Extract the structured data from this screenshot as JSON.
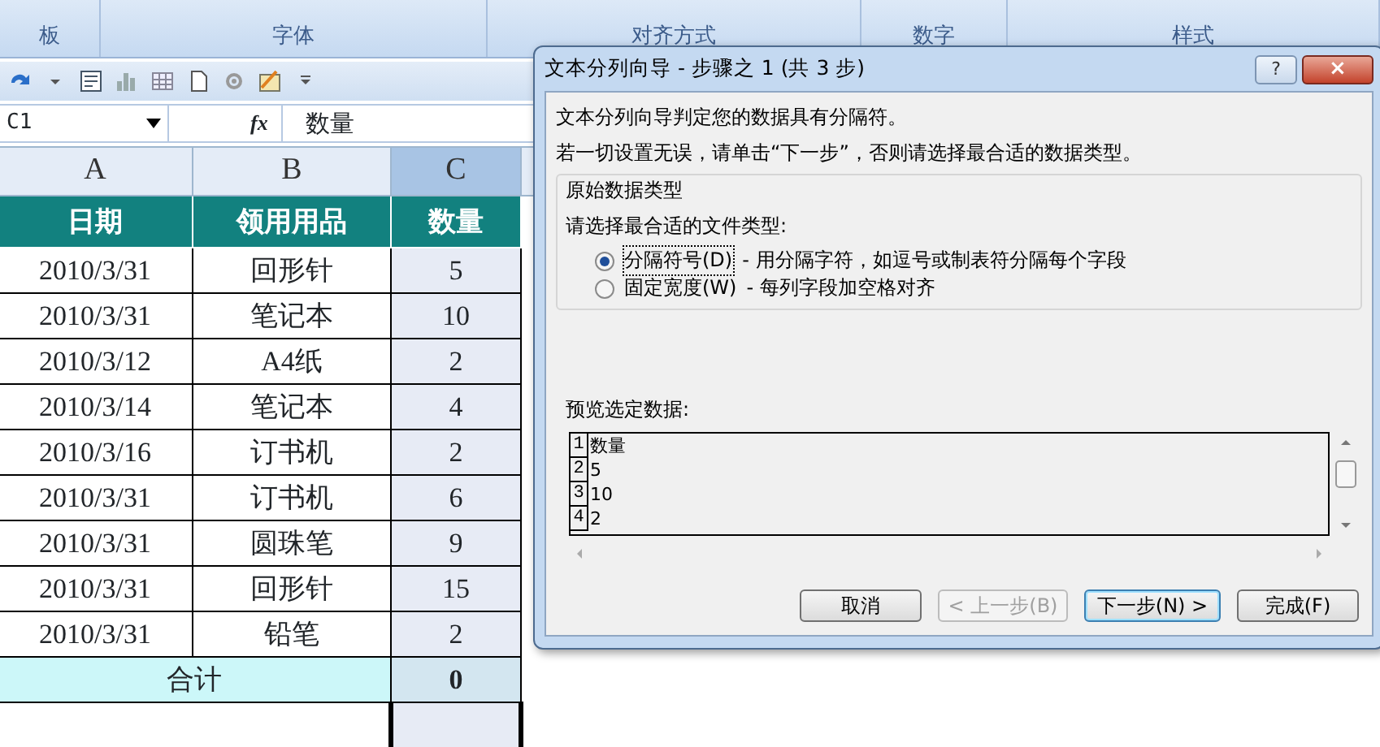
{
  "ribbon_groups": [
    {
      "label": "板"
    },
    {
      "label": "字体"
    },
    {
      "label": "对齐方式"
    },
    {
      "label": "数字"
    },
    {
      "label": "样式"
    }
  ],
  "formula_bar": {
    "name_box": "C1",
    "function_symbol": "fx",
    "value": "数量"
  },
  "columns": [
    {
      "label": "A",
      "selected": false
    },
    {
      "label": "B",
      "selected": false
    },
    {
      "label": "C",
      "selected": true
    }
  ],
  "table": {
    "header": [
      "日期",
      "领用用品",
      "数量"
    ],
    "rows": [
      [
        "2010/3/31",
        "回形针",
        "5"
      ],
      [
        "2010/3/31",
        "笔记本",
        "10"
      ],
      [
        "2010/3/12",
        "A4纸",
        "2"
      ],
      [
        "2010/3/14",
        "笔记本",
        "4"
      ],
      [
        "2010/3/16",
        "订书机",
        "2"
      ],
      [
        "2010/3/31",
        "订书机",
        "6"
      ],
      [
        "2010/3/31",
        "圆珠笔",
        "9"
      ],
      [
        "2010/3/31",
        "回形针",
        "15"
      ],
      [
        "2010/3/31",
        "铅笔",
        "2"
      ]
    ],
    "total": {
      "label": "合计",
      "value": "0"
    }
  },
  "dialog": {
    "title": "文本分列向导 - 步骤之 1 (共 3 步)",
    "help": "?",
    "close": "×",
    "intro": [
      "文本分列向导判定您的数据具有分隔符。",
      "若一切设置无误，请单击“下一步”，否则请选择最合适的数据类型。"
    ],
    "group_title": "原始数据类型",
    "prompt": "请选择最合适的文件类型:",
    "options": [
      {
        "label": "分隔符号(D)",
        "hint": "- 用分隔字符，如逗号或制表符分隔每个字段",
        "selected": true
      },
      {
        "label": "固定宽度(W)",
        "hint": "- 每列字段加空格对齐",
        "selected": false
      }
    ],
    "preview_label": "预览选定数据:",
    "preview_rows": [
      {
        "number": "1",
        "text": "数量"
      },
      {
        "number": "2",
        "text": "5"
      },
      {
        "number": "3",
        "text": "10"
      },
      {
        "number": "4",
        "text": "2"
      }
    ],
    "buttons": [
      {
        "label": "取消",
        "disabled": false,
        "default": false
      },
      {
        "label": "< 上一步(B)",
        "disabled": true,
        "default": false
      },
      {
        "label": "下一步(N) >",
        "disabled": false,
        "default": true
      },
      {
        "label": "完成(F)",
        "disabled": false,
        "default": false
      }
    ]
  }
}
